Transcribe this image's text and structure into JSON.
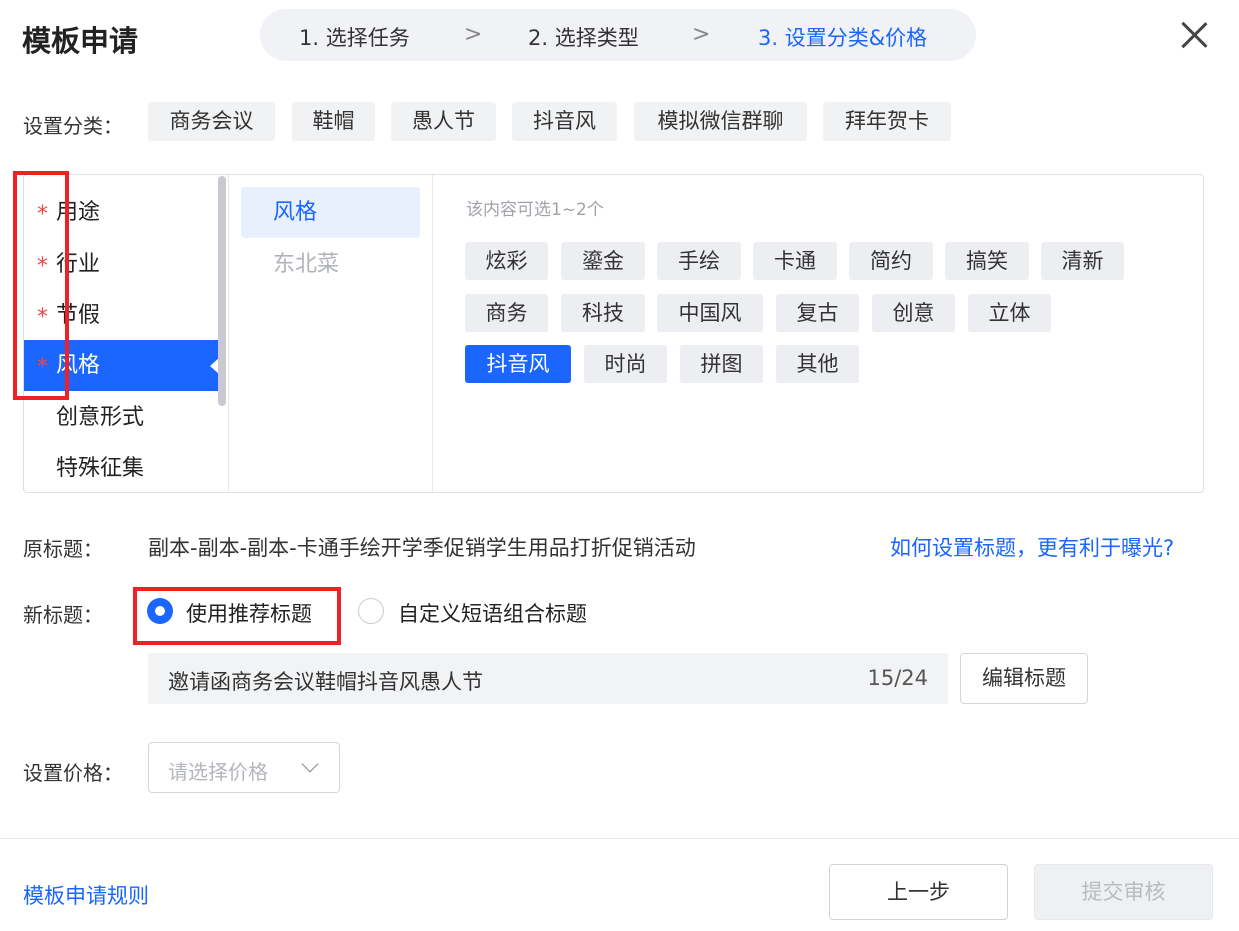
{
  "header": {
    "title": "模板申请",
    "steps": [
      "1. 选择任务",
      "2. 选择类型",
      "3. 设置分类&价格"
    ],
    "active_step": 3
  },
  "category_setting": {
    "label": "设置分类：",
    "chips": [
      "商务会议",
      "鞋帽",
      "愚人节",
      "抖音风",
      "模拟微信群聊",
      "拜年贺卡"
    ]
  },
  "categories": [
    {
      "label": "用途",
      "required": "*"
    },
    {
      "label": "行业",
      "required": "*"
    },
    {
      "label": "节假",
      "required": "*"
    },
    {
      "label": "风格",
      "required": "*",
      "selected": true
    },
    {
      "label": "创意形式"
    },
    {
      "label": "特殊征集"
    }
  ],
  "subcategories": [
    {
      "label": "风格",
      "selected": true
    },
    {
      "label": "东北菜"
    }
  ],
  "style_tags": {
    "hint": "该内容可选1~2个",
    "tags": [
      "炫彩",
      "鎏金",
      "手绘",
      "卡通",
      "简约",
      "搞笑",
      "清新",
      "商务",
      "科技",
      "中国风",
      "复古",
      "创意",
      "立体",
      "抖音风",
      "时尚",
      "拼图",
      "其他"
    ],
    "selected": "抖音风"
  },
  "original_title": {
    "label": "原标题：",
    "value": "副本-副本-副本-卡通手绘开学季促销学生用品打折促销活动",
    "help_link": "如何设置标题，更有利于曝光?"
  },
  "new_title": {
    "label": "新标题：",
    "options": [
      "使用推荐标题",
      "自定义短语组合标题"
    ],
    "selected_option": "使用推荐标题",
    "value": "邀请函商务会议鞋帽抖音风愚人节",
    "count": "15/24",
    "edit_button": "编辑标题"
  },
  "price": {
    "label": "设置价格：",
    "placeholder": "请选择价格"
  },
  "footer": {
    "rules_link": "模板申请规则",
    "prev_button": "上一步",
    "submit_button": "提交审核"
  },
  "colors": {
    "accent": "#1a66ff",
    "required_star": "#f24646",
    "annotation_box": "#ee2222"
  }
}
